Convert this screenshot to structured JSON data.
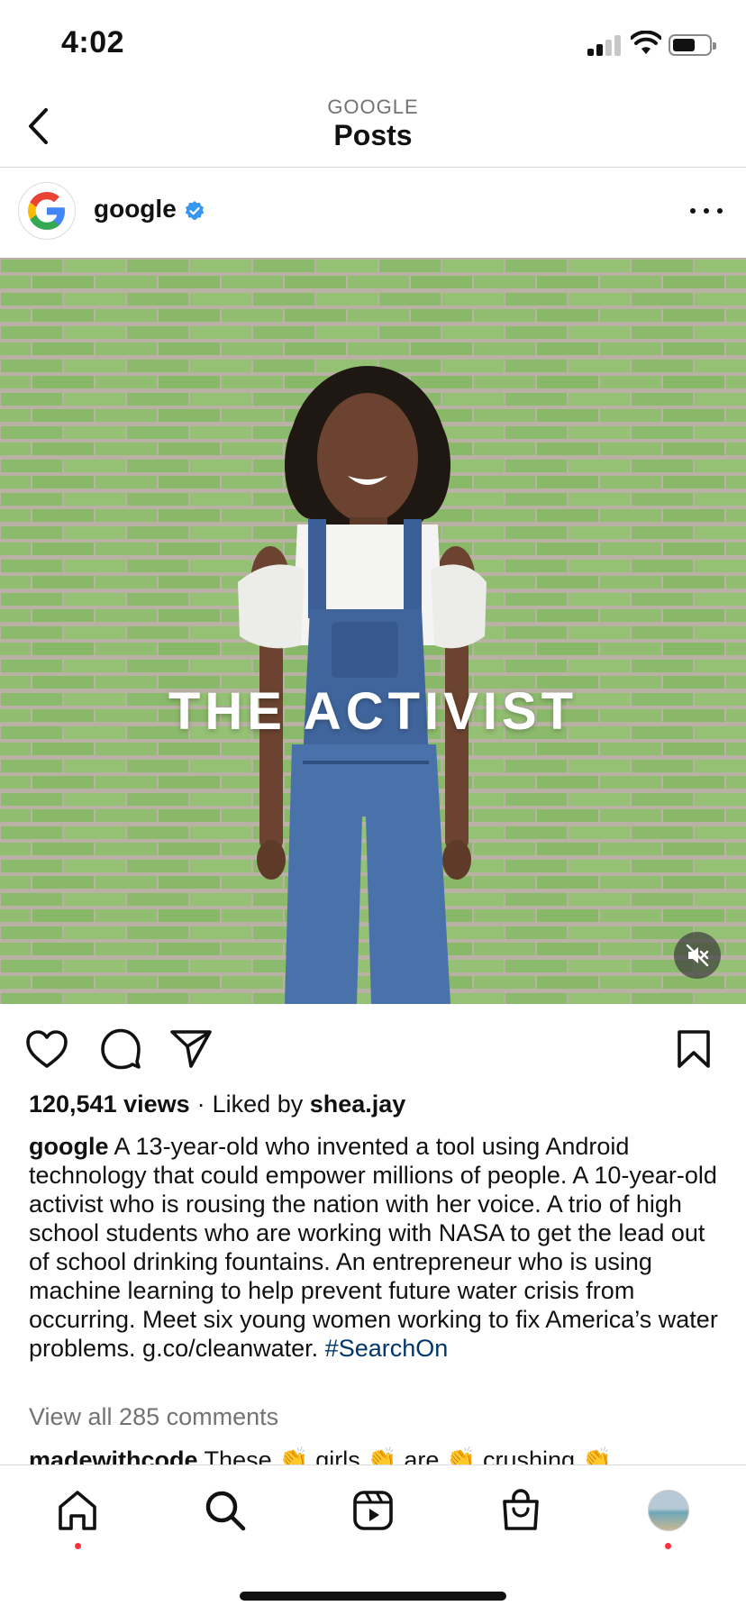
{
  "status_bar": {
    "time": "4:02"
  },
  "header": {
    "account_label": "GOOGLE",
    "title": "Posts"
  },
  "post": {
    "username": "google",
    "media": {
      "overlay_text": "THE ACTIVIST"
    },
    "stats": {
      "views": "120,541 views",
      "separator": "·",
      "liked_by_prefix": "Liked by",
      "liked_by_user": "shea.jay"
    },
    "caption": {
      "username": "google",
      "text": " A 13-year-old who invented a tool using Android technology that could empower millions of people. A 10-year-old activist who is rousing the nation with her voice. A trio of high school students who are working with NASA to get the lead out of school drinking fountains. An entrepreneur who is using machine learning to help prevent future water crisis from occurring. Meet six young women working to fix America’s water problems. g.co/cleanwater. ",
      "hashtag": "#SearchOn"
    },
    "view_all_comments": "View all 285 comments",
    "comment_preview": {
      "username": "madewithcode",
      "text": " These 👏 girls 👏 are 👏 crushing 👏"
    }
  },
  "icons": {
    "back": "chevron-left-icon",
    "verified": "verified-badge-icon",
    "more": "more-horizontal-icon",
    "mute": "muted-speaker-icon",
    "like": "heart-icon",
    "comment": "comment-bubble-icon",
    "share": "send-plane-icon",
    "save": "bookmark-icon",
    "tabs": [
      "home-icon",
      "search-icon",
      "reels-icon",
      "shop-bag-icon",
      "profile-avatar"
    ]
  },
  "colors": {
    "verified_blue": "#3897f0",
    "hashtag_blue": "#00376b",
    "notification_dot": "#ff3040",
    "brick_green": "#8fbb6e"
  }
}
